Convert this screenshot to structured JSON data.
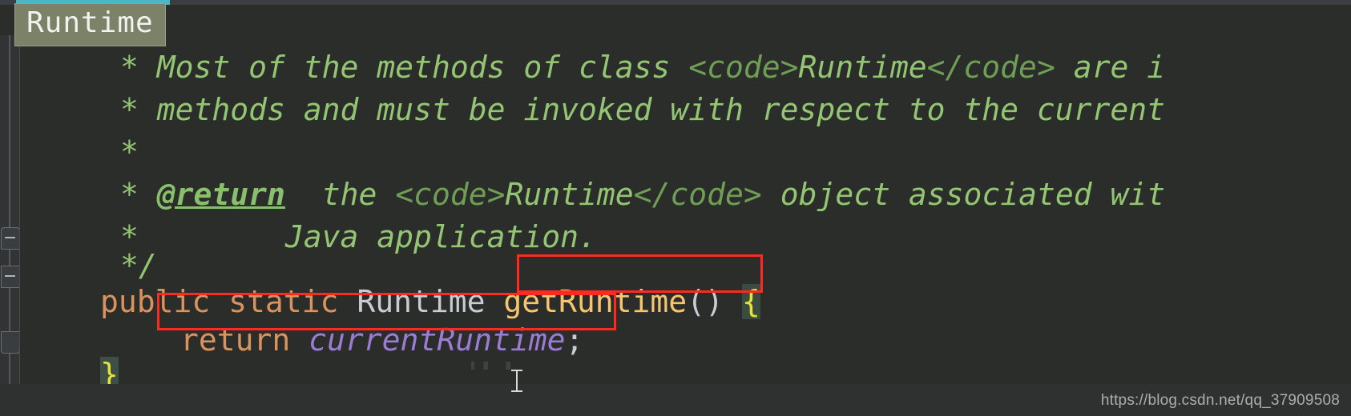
{
  "editor": {
    "breadcrumb_label": "Runtime",
    "accent_color": "#4bb6c4",
    "background_color": "#2b2d2b",
    "gutter_color": "#313335",
    "annotation_color": "#ff2a1f"
  },
  "code": {
    "line1": {
      "star": "*",
      "text_a": " Most of the methods of class ",
      "tag_open": "<code>",
      "word": "Runtime",
      "tag_close": "</code>",
      "text_b": " are i"
    },
    "line2": {
      "star": "*",
      "text": " methods and must be invoked with respect to the current"
    },
    "line3": {
      "star": "*"
    },
    "line4": {
      "star": "*",
      "tag": "@return",
      "text_a": "  the ",
      "tag_open": "<code>",
      "word": "Runtime",
      "tag_close": "</code>",
      "text_b": " object associated wit"
    },
    "line5": {
      "star": "*",
      "text": "        Java application."
    },
    "line6": {
      "text": "*/"
    },
    "line7": {
      "kw_public": "public",
      "kw_static": "static",
      "return_type": "Runtime",
      "method_name": "getRuntime",
      "parens": "()",
      "open_brace": "{"
    },
    "line8": {
      "kw_return": "return",
      "field": "currentRuntime",
      "semicolon": ";"
    },
    "line9": {
      "close_brace": "}"
    }
  },
  "gutter": {
    "fold_top": "fold-marker-collapse",
    "fold_mid": "fold-marker-collapse",
    "fold_bottom": "fold-marker-end"
  },
  "footer": {
    "watermark": "https://blog.csdn.net/qq_37909508"
  }
}
